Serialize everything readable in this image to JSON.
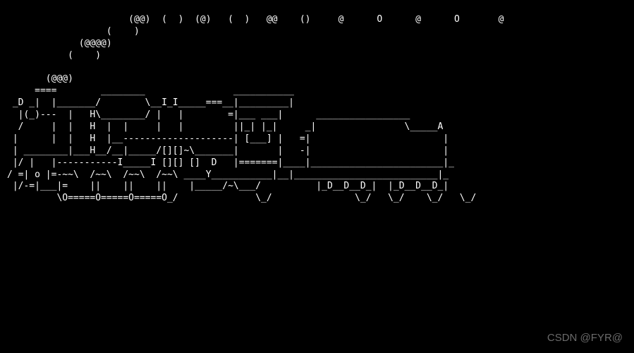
{
  "terminal": {
    "ascii_art": "                      (@@)  (  )  (@)   (  )   @@    ()     @      O      @      O       @\n                  (    )\n             (@@@@)\n           (    )\n\n       (@@@)\n     ====        ________                ___________\n _D _|  |_______/        \\__I_I_____===__|_________|\n  |(_)---  |   H\\________/ |   |        =|___ ___|      _________________\n  /     |  |   H  |  |     |   |         ||_| |_|     _|                \\_____A\n |      |  |   H  |__--------------------| [___] |   =|                        |\n | ________|___H__/__|_____/[][]~\\_______|       |   -|                        |\n |/ |   |-----------I_____I [][] []  D   |=======|____|________________________|_\n/ =| o |=-~~\\  /~~\\  /~~\\  /~~\\ ____Y___________|__|__________________________|_\n |/-=|___|=    ||    ||    ||    |_____/~\\___/          |_D__D__D_|  |_D__D__D_|\n         \\O=====O=====O=====O_/              \\_/               \\_/   \\_/    \\_/   \\_/"
  },
  "watermark": {
    "text": "CSDN @FYR@"
  }
}
